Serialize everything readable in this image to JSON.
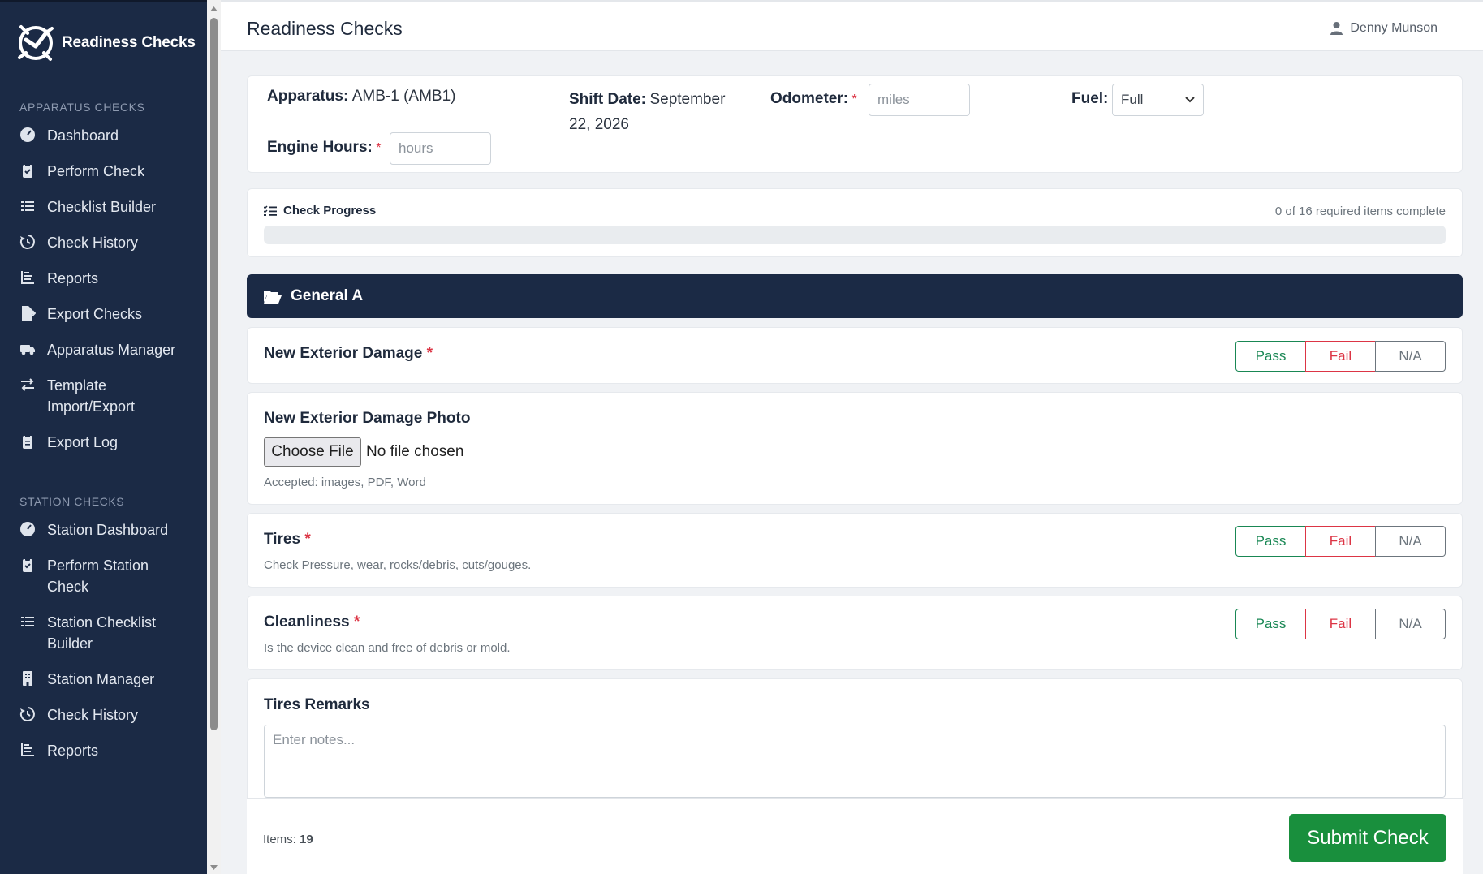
{
  "app": {
    "brand_name": "Readiness Checks",
    "page_title": "Readiness Checks",
    "user_name": "Denny Munson"
  },
  "sidebar": {
    "apparatus_section": "APPARATUS CHECKS",
    "apparatus_items": [
      {
        "label": "Dashboard",
        "icon": "gauge-icon"
      },
      {
        "label": "Perform Check",
        "icon": "clipboard-check-icon"
      },
      {
        "label": "Checklist Builder",
        "icon": "list-icon"
      },
      {
        "label": "Check History",
        "icon": "history-icon"
      },
      {
        "label": "Reports",
        "icon": "chart-icon"
      },
      {
        "label": "Export Checks",
        "icon": "file-export-icon"
      },
      {
        "label": "Apparatus Manager",
        "icon": "truck-icon"
      },
      {
        "label": "Template Import/Export",
        "icon": "exchange-icon"
      },
      {
        "label": "Export Log",
        "icon": "clipboard-list-icon"
      }
    ],
    "station_section": "STATION CHECKS",
    "station_items": [
      {
        "label": "Station Dashboard",
        "icon": "gauge-icon"
      },
      {
        "label": "Perform Station Check",
        "icon": "clipboard-check-icon"
      },
      {
        "label": "Station Checklist Builder",
        "icon": "list-icon"
      },
      {
        "label": "Station Manager",
        "icon": "building-icon"
      },
      {
        "label": "Check History",
        "icon": "history-icon"
      },
      {
        "label": "Reports",
        "icon": "chart-icon"
      }
    ]
  },
  "info": {
    "apparatus_label": "Apparatus:",
    "apparatus_value": "AMB-1 (AMB1)",
    "shift_label": "Shift Date:",
    "shift_value_line1": "September",
    "shift_value_line2": "22, 2026",
    "odometer_label": "Odometer:",
    "odometer_placeholder": "miles",
    "fuel_label": "Fuel:",
    "fuel_value": "Full",
    "engine_hours_label": "Engine Hours:",
    "engine_hours_placeholder": "hours",
    "required_mark": "*"
  },
  "progress": {
    "title": "Check Progress",
    "count_text": "0 of 16 required items complete",
    "completed": 0,
    "required": 16
  },
  "section": {
    "title": "General A"
  },
  "buttons": {
    "pass": "Pass",
    "fail": "Fail",
    "na": "N/A"
  },
  "items": {
    "exterior_damage": {
      "title": "New Exterior Damage",
      "required": "*"
    },
    "damage_photo": {
      "title": "New Exterior Damage Photo",
      "choose_file": "Choose File",
      "no_file": "No file chosen",
      "accepted": "Accepted: images, PDF, Word"
    },
    "tires": {
      "title": "Tires",
      "required": "*",
      "desc": "Check Pressure, wear, rocks/debris, cuts/gouges."
    },
    "cleanliness": {
      "title": "Cleanliness",
      "required": "*",
      "desc": "Is the device clean and free of debris or mold."
    },
    "tires_remarks": {
      "title": "Tires Remarks",
      "placeholder": "Enter notes..."
    }
  },
  "footer": {
    "items_label": "Items:",
    "items_count": "19",
    "submit": "Submit Check"
  },
  "colors": {
    "sidebar_bg": "#1b2a45",
    "pass": "#198754",
    "fail": "#dc3545",
    "submit": "#198f3d"
  }
}
